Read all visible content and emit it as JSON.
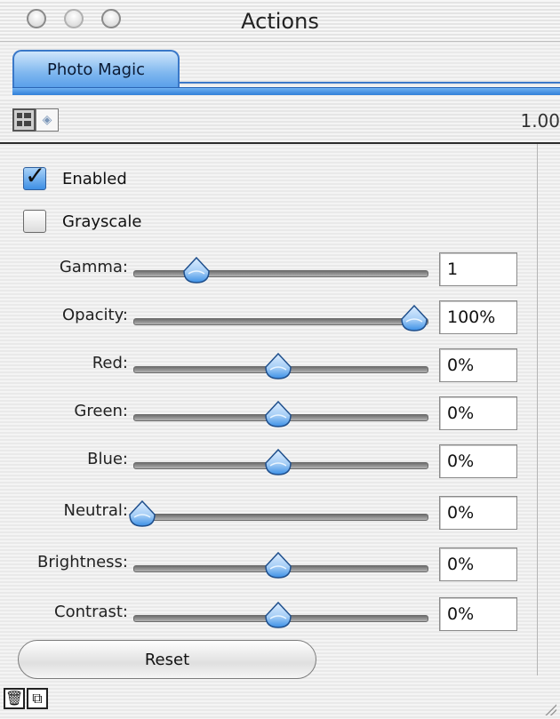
{
  "window": {
    "title": "Actions"
  },
  "tab": {
    "label": "Photo Magic"
  },
  "toolbar": {
    "zoom": "1.00"
  },
  "checks": [
    {
      "label": "Enabled",
      "checked": true
    },
    {
      "label": "Grayscale",
      "checked": false
    }
  ],
  "sliders": [
    {
      "label": "Gamma:",
      "value": "1",
      "position": 0.2
    },
    {
      "label": "Opacity:",
      "value": "100%",
      "position": 1.0
    },
    {
      "label": "Red:",
      "value": "0%",
      "position": 0.5
    },
    {
      "label": "Green:",
      "value": "0%",
      "position": 0.5
    },
    {
      "label": "Blue:",
      "value": "0%",
      "position": 0.5
    },
    {
      "label": "Neutral:",
      "value": "0%",
      "position": 0.0
    },
    {
      "label": "Brightness:",
      "value": "0%",
      "position": 0.5
    },
    {
      "label": "Contrast:",
      "value": "0%",
      "position": 0.5
    }
  ],
  "buttons": {
    "reset": "Reset"
  },
  "icons": {
    "trash": "trash-icon",
    "duplicate": "duplicate-icon",
    "list_view": "list-view-icon",
    "effects": "effects-icon"
  },
  "colors": {
    "accent": "#5aa0ea",
    "thumb_top": "#dcecff",
    "thumb_bottom": "#3b8fe6"
  }
}
